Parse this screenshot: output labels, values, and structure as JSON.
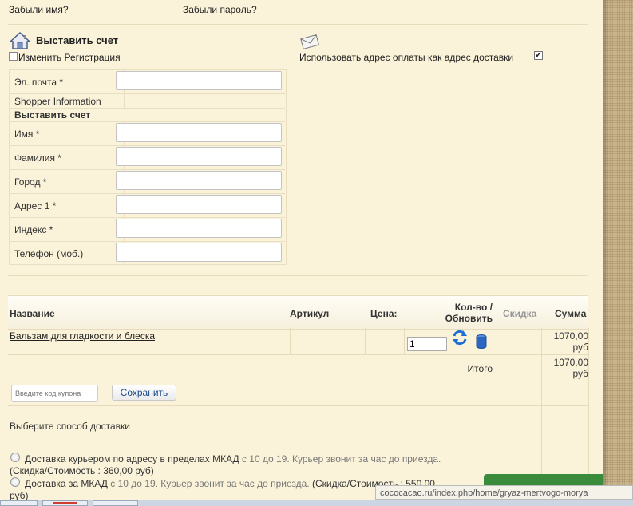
{
  "links": {
    "forgot_name": "Забыли имя?",
    "forgot_password": "Забыли пароль?"
  },
  "billing": {
    "heading": "Выставить счет",
    "change_registration": "Изменить Регистрация",
    "use_billing_address": "Использовать адрес оплаты как адрес доставки",
    "email_label": "Эл. почта *",
    "shopper_info": "Shopper Information",
    "section_title": "Выставить счет",
    "first_name_label": "Имя *",
    "last_name_label": "Фамилия *",
    "city_label": "Город *",
    "address_label": "Адрес 1 *",
    "zip_label": "Индекс *",
    "phone_label": "Телефон (моб.)"
  },
  "cart": {
    "headers": {
      "name": "Название",
      "sku": "Артикул",
      "price": "Цена:",
      "qty_line1": "Кол-во /",
      "qty_line2": "Обновить",
      "discount": "Скидка",
      "total": "Сумма"
    },
    "item": {
      "name": "Бальзам для гладкости и блеска",
      "qty": "1",
      "total_line1": "1070,00",
      "total_line2": "руб"
    },
    "summary": {
      "label": "Итого",
      "total_line1": "1070,00",
      "total_line2": "руб"
    },
    "coupon_placeholder": "Введите код купона",
    "save_button": "Сохранить"
  },
  "shipping": {
    "title": "Выберите способ доставки",
    "option1_name": "Доставка курьером по адресу в пределах МКАД",
    "option1_desc": "с 10 до 19. Курьер звонит за час до приезда.",
    "option1_cost": "(Скидка/Стоимость : 360,00 руб)",
    "option2_name": "Доставка за МКАД",
    "option2_desc": "с 10 до 19. Курьер звонит за час до приезда.",
    "option2_cost_partial": "(Скидка/Стоимость : 550,00",
    "option2_cost_tail": "руб)"
  },
  "status_url": "cococacao.ru/index.php/home/gryaz-mertvogo-morya",
  "icons": {
    "house": "house-icon",
    "envelope": "envelope-icon",
    "refresh": "refresh-icon",
    "delete": "trash-icon"
  }
}
